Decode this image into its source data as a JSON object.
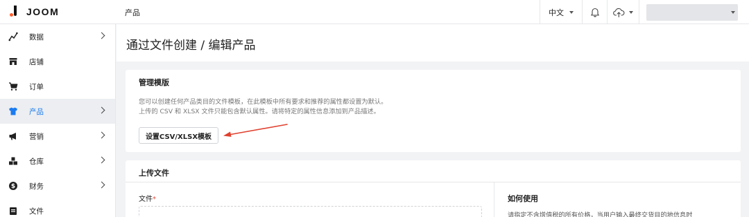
{
  "app": {
    "logo_text": "JOOM",
    "top_title": "产品"
  },
  "topbar": {
    "language": "中文",
    "account_name": ""
  },
  "sidebar": {
    "items": [
      {
        "label": "数据",
        "icon": "chart-line-icon",
        "chevron": true
      },
      {
        "label": "店铺",
        "icon": "store-icon",
        "chevron": false
      },
      {
        "label": "订单",
        "icon": "cart-icon",
        "chevron": false
      },
      {
        "label": "产品",
        "icon": "tshirt-icon",
        "chevron": true,
        "active": true
      },
      {
        "label": "营销",
        "icon": "megaphone-icon",
        "chevron": true
      },
      {
        "label": "仓库",
        "icon": "boxes-icon",
        "chevron": true
      },
      {
        "label": "财务",
        "icon": "dollar-icon",
        "chevron": true
      },
      {
        "label": "文件",
        "icon": "file-icon",
        "chevron": false
      }
    ]
  },
  "page": {
    "title": "通过文件创建 / 编辑产品"
  },
  "manage_templates": {
    "title": "管理模版",
    "desc_line1": "您可以创建任何产品类目的文件模板，在此模板中所有要求和推荐的属性都设置为默认。",
    "desc_line2": "上传的 CSV 和 XLSX 文件只能包含默认属性。请将特定的属性信息添加到产品描述。",
    "button_label": "设置CSV/XLSX模板"
  },
  "upload": {
    "title": "上传文件",
    "file_label": "文件",
    "required_mark": "*",
    "howto_title": "如何使用",
    "howto_text": "请指定不含增值税的所有价格，当用户输入最终交货目的地信息时"
  },
  "colors": {
    "accent": "#1b7bf0",
    "logo_dot": "#ff5f2e",
    "annotation_arrow": "#e0412f"
  }
}
